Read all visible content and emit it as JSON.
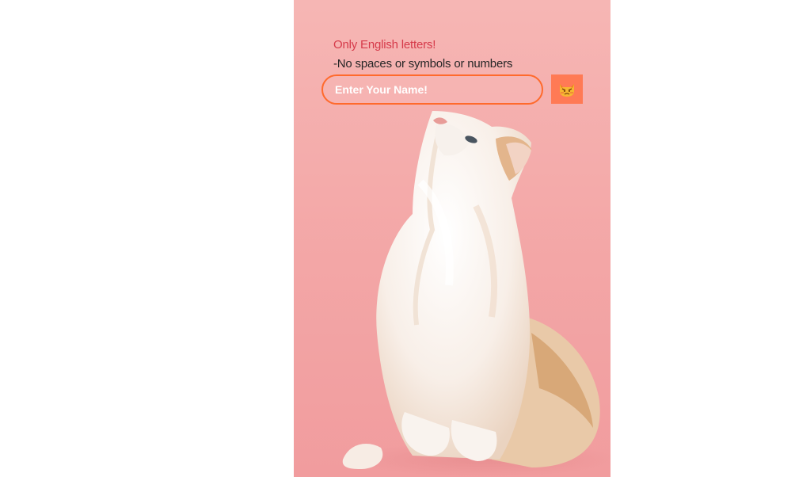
{
  "form": {
    "warning": "Only English letters!",
    "rule": "-No spaces or symbols or numbers",
    "name_placeholder": "Enter Your Name!",
    "name_value": "",
    "submit_icon": "pouting-cat-emoji-icon"
  },
  "colors": {
    "background": "#f3a6a6",
    "warning_text": "#d63a4a",
    "input_border": "#ff6a2c",
    "button_bg": "#ff7a55"
  }
}
